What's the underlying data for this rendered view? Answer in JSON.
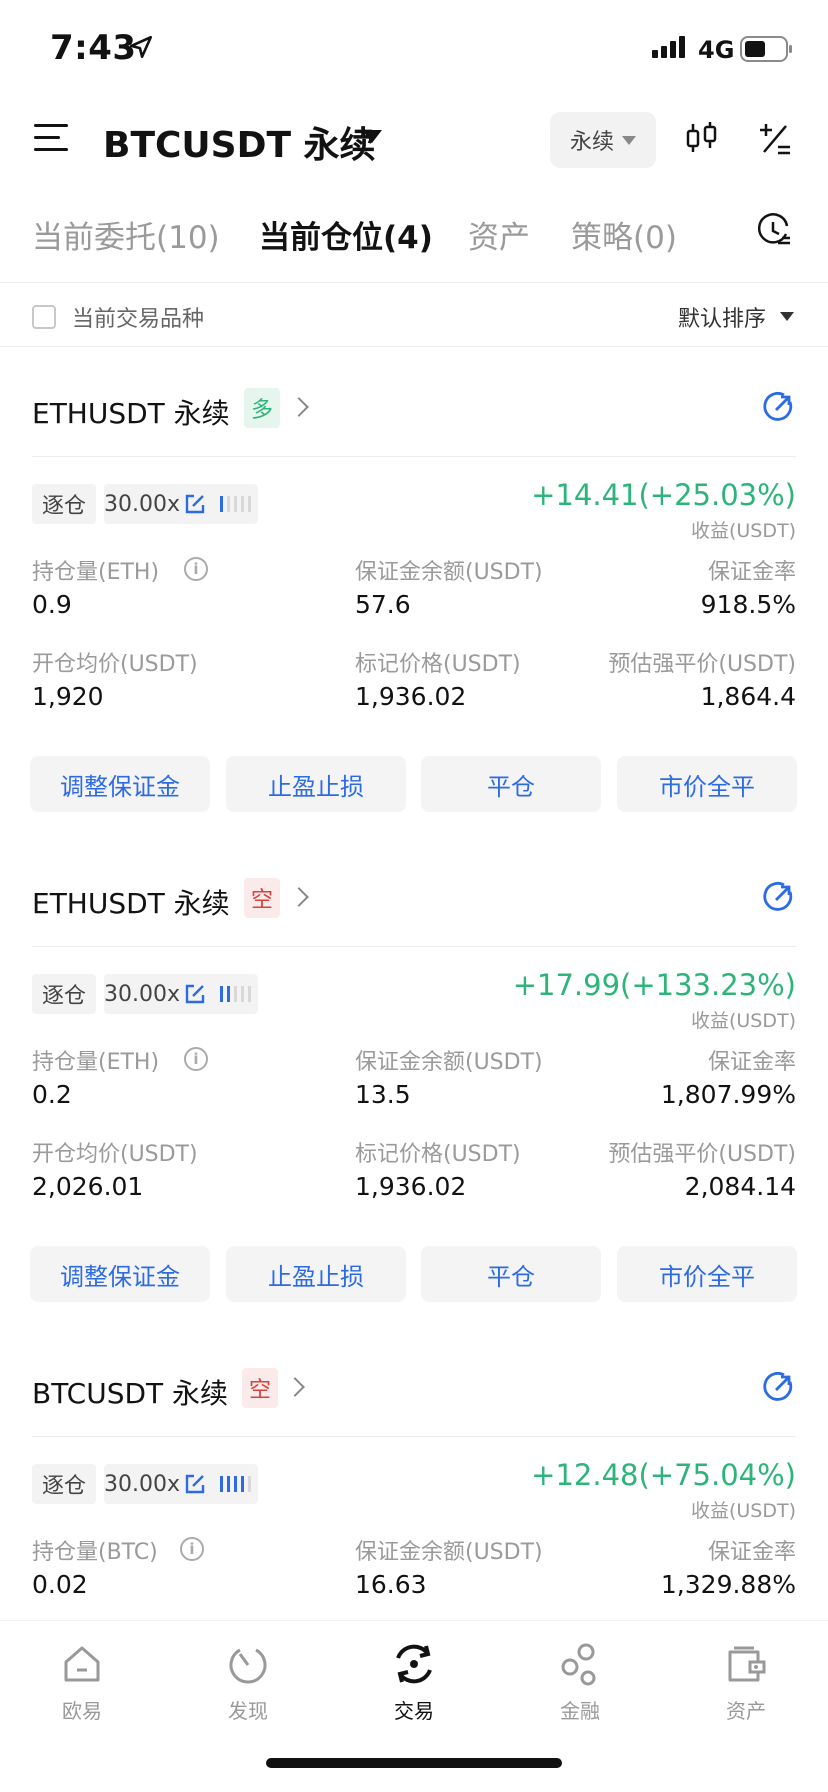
{
  "status_bar": {
    "time": "7:43",
    "network": "4G"
  },
  "header": {
    "symbol": "BTCUSDT 永续",
    "contract_type": "永续"
  },
  "tabs": [
    {
      "label": "当前委托(10)",
      "active": false
    },
    {
      "label": "当前仓位(4)",
      "active": true
    },
    {
      "label": "资产",
      "active": false
    },
    {
      "label": "策略(0)",
      "active": false
    }
  ],
  "filter": {
    "label": "当前交易品种",
    "sort": "默认排序"
  },
  "positions": [
    {
      "symbol": "ETHUSDT 永续",
      "side": "多",
      "side_type": "long",
      "margin_mode": "逐仓",
      "leverage": "30.00x",
      "leverage_bars_on": 1,
      "pnl": "+14.41(+25.03%)",
      "pnl_label": "收益(USDT)",
      "size_label": "持仓量(ETH)",
      "size": "0.9",
      "margin_label": "保证金余额(USDT)",
      "margin": "57.6",
      "margin_ratio_label": "保证金率",
      "margin_ratio": "918.5%",
      "entry_label": "开仓均价(USDT)",
      "entry": "1,920",
      "mark_label": "标记价格(USDT)",
      "mark": "1,936.02",
      "liq_label": "预估强平价(USDT)",
      "liq": "1,864.4",
      "buttons": [
        "调整保证金",
        "止盈止损",
        "平仓",
        "市价全平"
      ]
    },
    {
      "symbol": "ETHUSDT 永续",
      "side": "空",
      "side_type": "short",
      "margin_mode": "逐仓",
      "leverage": "30.00x",
      "leverage_bars_on": 2,
      "pnl": "+17.99(+133.23%)",
      "pnl_label": "收益(USDT)",
      "size_label": "持仓量(ETH)",
      "size": "0.2",
      "margin_label": "保证金余额(USDT)",
      "margin": "13.5",
      "margin_ratio_label": "保证金率",
      "margin_ratio": "1,807.99%",
      "entry_label": "开仓均价(USDT)",
      "entry": "2,026.01",
      "mark_label": "标记价格(USDT)",
      "mark": "1,936.02",
      "liq_label": "预估强平价(USDT)",
      "liq": "2,084.14",
      "buttons": [
        "调整保证金",
        "止盈止损",
        "平仓",
        "市价全平"
      ]
    },
    {
      "symbol": "BTCUSDT 永续",
      "side": "空",
      "side_type": "short",
      "margin_mode": "逐仓",
      "leverage": "30.00x",
      "leverage_bars_on": 4,
      "pnl": "+12.48(+75.04%)",
      "pnl_label": "收益(USDT)",
      "size_label": "持仓量(BTC)",
      "size": "0.02",
      "margin_label": "保证金余额(USDT)",
      "margin": "16.63",
      "margin_ratio_label": "保证金率",
      "margin_ratio": "1,329.88%"
    }
  ],
  "bottom_nav": [
    {
      "label": "欧易",
      "icon": "home-icon",
      "active": false
    },
    {
      "label": "发现",
      "icon": "discover-icon",
      "active": false
    },
    {
      "label": "交易",
      "icon": "trade-icon",
      "active": true
    },
    {
      "label": "金融",
      "icon": "finance-icon",
      "active": false
    },
    {
      "label": "资产",
      "icon": "wallet-icon",
      "active": false
    }
  ],
  "colors": {
    "green": "#2db47a",
    "red": "#d9413b",
    "blue": "#2d6be4"
  }
}
